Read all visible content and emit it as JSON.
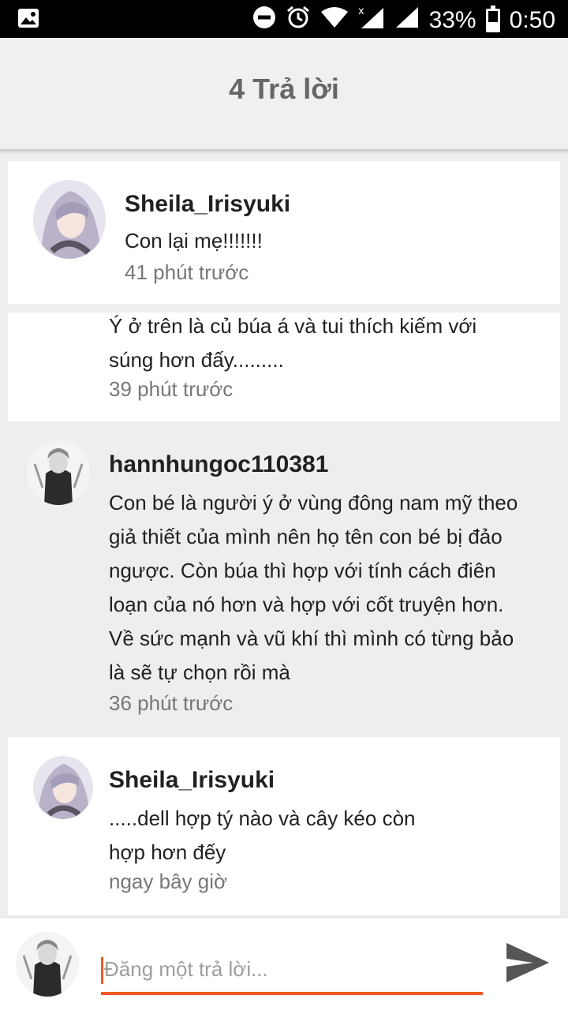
{
  "status_bar": {
    "battery": "33%",
    "time": "0:50"
  },
  "header": {
    "title": "4 Trả lời"
  },
  "comments": [
    {
      "username": "Sheila_Irisyuki",
      "message": "Con lại mẹ!!!!!!!",
      "time": "41 phút trước"
    },
    {
      "username": "",
      "message_lines": [
        "Ý ở trên là củ búa á và tui thích kiếm với",
        "súng hơn đấy........."
      ],
      "time": "39 phút trước"
    },
    {
      "username": "hannhungoc110381",
      "message_lines": [
        "Con bé là người ý ở vùng đông nam mỹ theo",
        "giả thiết của mình nên họ tên con bé bị đảo",
        "ngược. Còn búa thì hợp với tính cách điên",
        "loạn của nó hơn và hợp với cốt truyện hơn.",
        "Về sức mạnh và vũ khí thì mình có từng bảo",
        "là sẽ tự chọn rồi mà"
      ],
      "time": "36 phút trước"
    },
    {
      "username": "Sheila_Irisyuki",
      "message_lines": [
        ".....dell hợp tý nào và cây kéo còn",
        "hợp hơn đếy"
      ],
      "time": "ngay bây giờ"
    }
  ],
  "reply_box": {
    "placeholder": "Đăng một trả lời..."
  },
  "colors": {
    "accent": "#f05a22",
    "header_bg": "#f0f0f0",
    "page_bg": "#eeeeee"
  }
}
